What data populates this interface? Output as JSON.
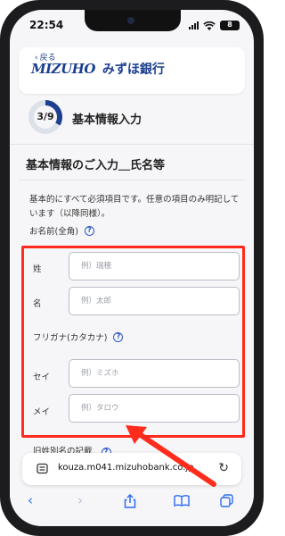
{
  "status": {
    "time": "22:54",
    "battery": "8"
  },
  "header": {
    "back_label": "戻る",
    "logo_mark": "MIZUHO",
    "bank_name": "みずほ銀行"
  },
  "progress": {
    "label": "3/9",
    "current": 3,
    "total": 9,
    "title": "基本情報入力"
  },
  "section": {
    "title": "基本情報のご入力＿氏名等",
    "description": "基本的にすべて必須項目です。任意の項目のみ明記しています（以降同様）。"
  },
  "name_group": {
    "label": "お名前(全角)",
    "help": "?",
    "sei_label": "姓",
    "sei_placeholder": "例）瑞穂",
    "mei_label": "名",
    "mei_placeholder": "例）太郎"
  },
  "kana_group": {
    "label": "フリガナ(カタカナ)",
    "help": "?",
    "sei_label": "セイ",
    "sei_placeholder": "例）ミズホ",
    "mei_label": "メイ",
    "mei_placeholder": "例）タロウ"
  },
  "next_label_partial": "旧姓別名の記載",
  "next_help": "?",
  "browser": {
    "url": "kouza.m041.mizuhobank.co.jp"
  },
  "colors": {
    "brand": "#1d3f8f",
    "accent_red": "#ff2b1c",
    "link": "#2c6bf0"
  }
}
